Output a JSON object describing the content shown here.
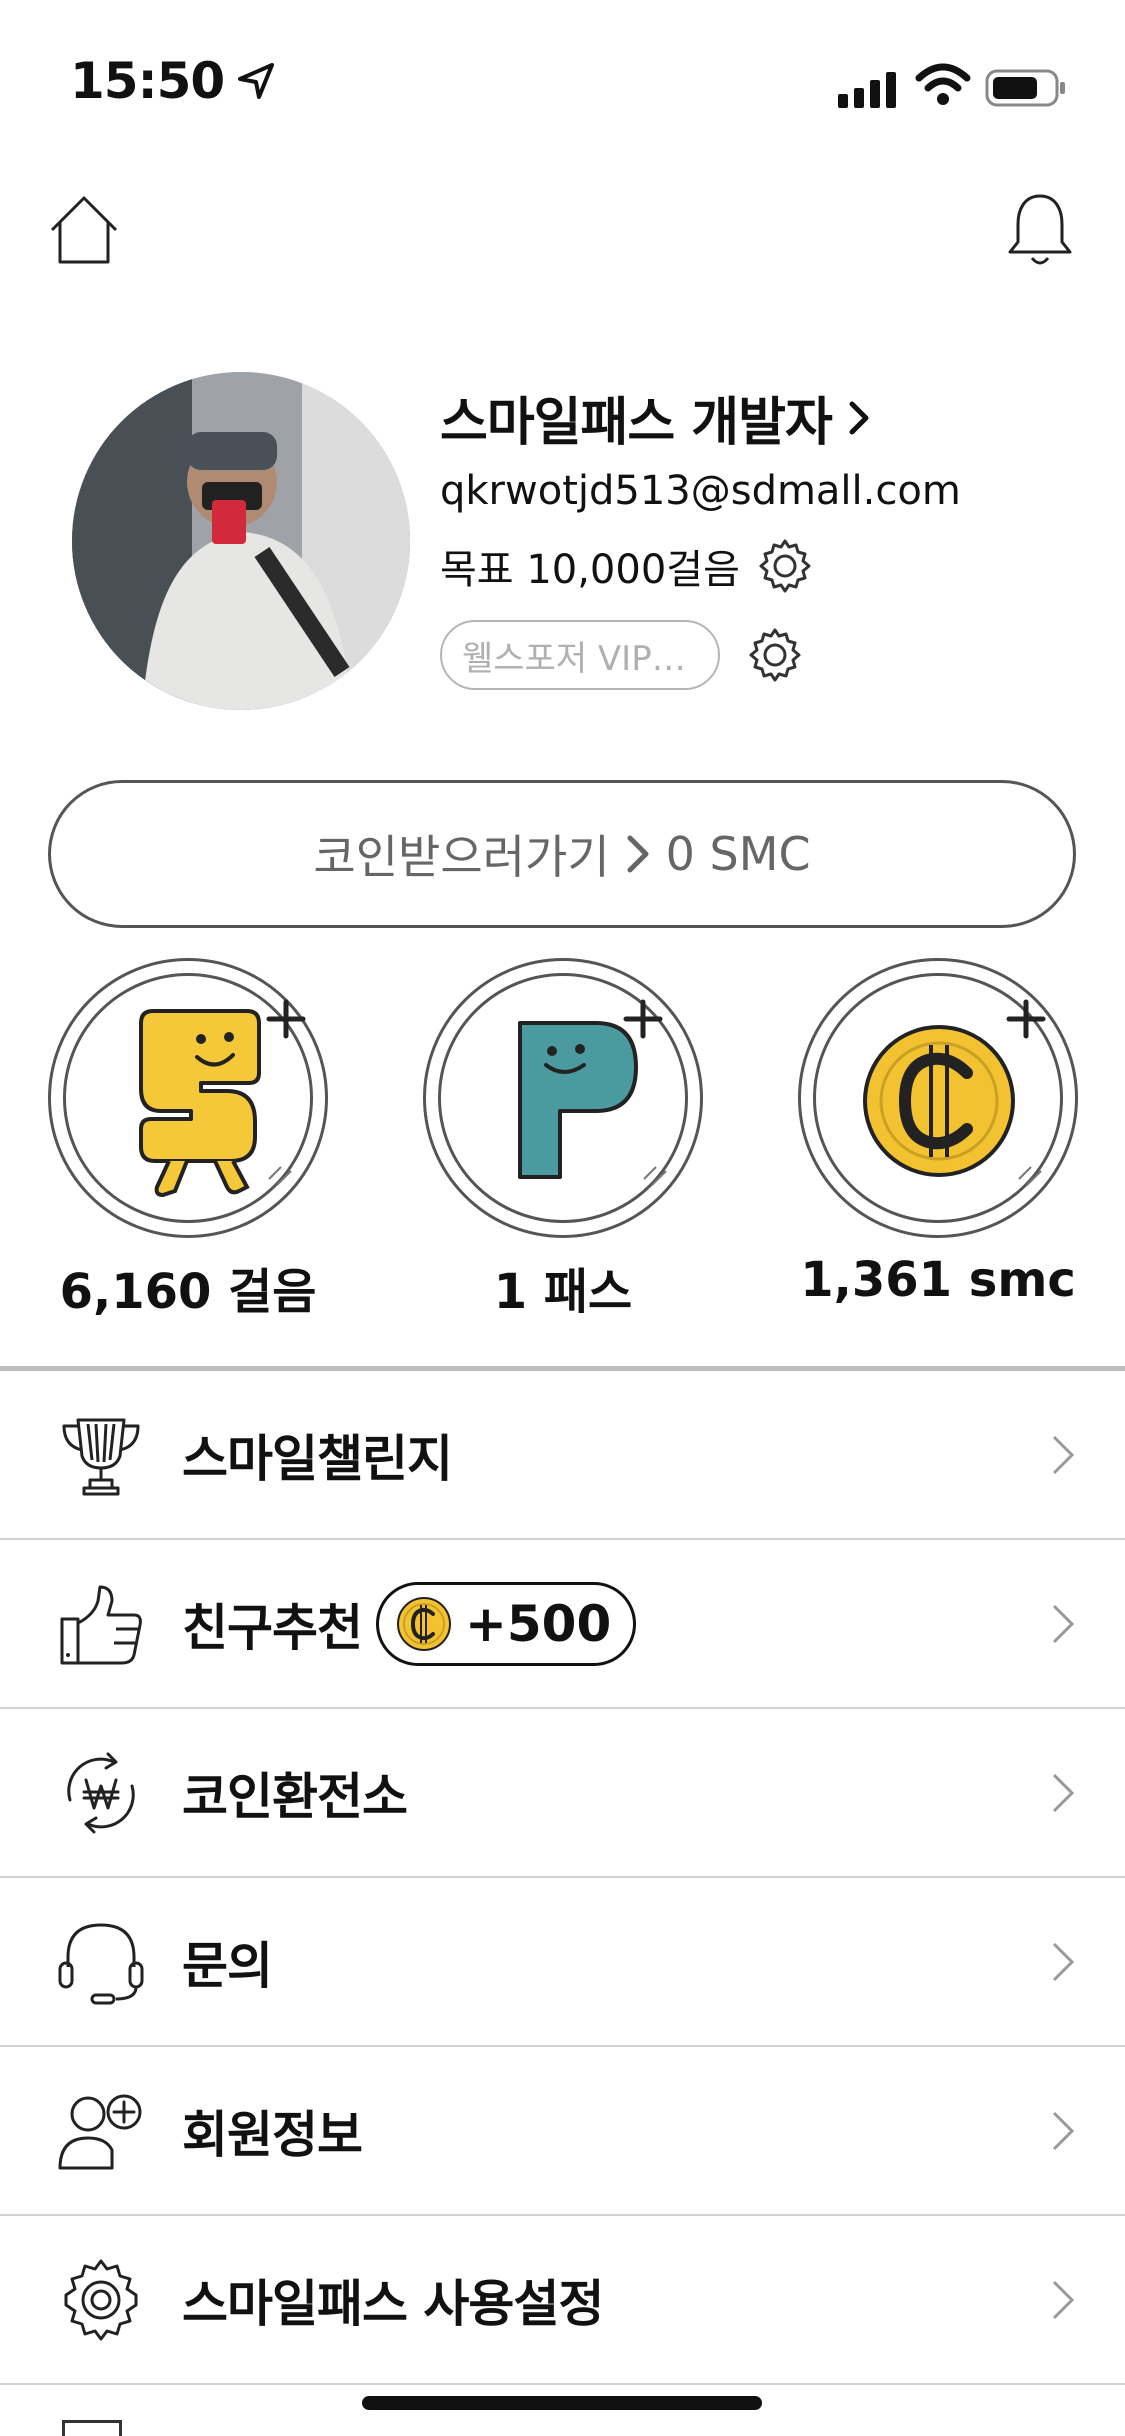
{
  "status_bar": {
    "time": "15:50"
  },
  "profile": {
    "name": "스마일패스 개발자",
    "email": "qkrwotjd513@sdmall.com",
    "goal": "목표 10,000걸음",
    "membership": "웰스포저 VIP…"
  },
  "coin_button": {
    "label": "코인받으러가기",
    "amount": "0 SMC"
  },
  "stats": [
    {
      "label": "6,160 걸음",
      "icon": "smile-s-character-icon",
      "color": "#F5C83A"
    },
    {
      "label": "1 패스",
      "icon": "smile-p-character-icon",
      "color": "#4A9AA0"
    },
    {
      "label": "1,361 smc",
      "icon": "coin-icon",
      "color": "#F2C230"
    }
  ],
  "menu": [
    {
      "label": "스마일챌린지",
      "icon": "trophy-icon"
    },
    {
      "label": "친구추천",
      "icon": "thumbs-up-icon",
      "bonus": "+500"
    },
    {
      "label": "코인환전소",
      "icon": "won-exchange-icon"
    },
    {
      "label": "문의",
      "icon": "headset-icon"
    },
    {
      "label": "회원정보",
      "icon": "add-user-icon"
    },
    {
      "label": "스마일패스 사용설정",
      "icon": "gear-icon"
    }
  ]
}
